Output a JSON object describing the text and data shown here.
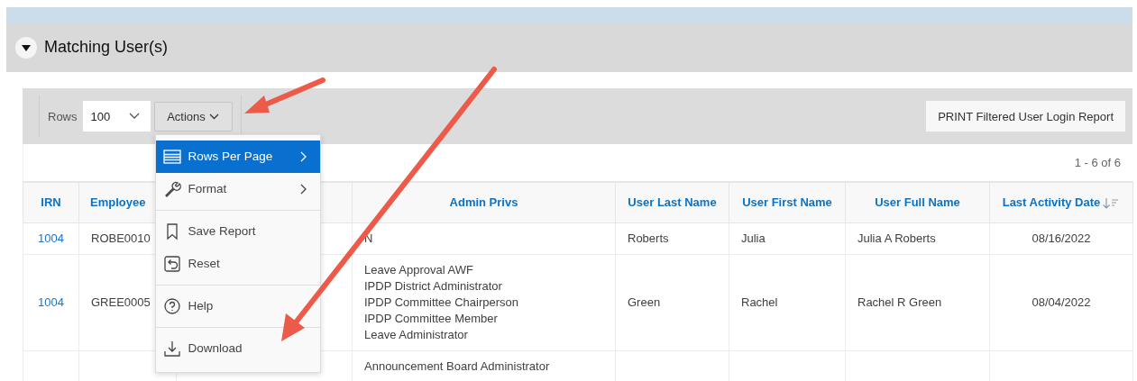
{
  "section": {
    "title": "Matching User(s)",
    "expanded": true
  },
  "toolbar": {
    "rows_label": "Rows",
    "rows_value": "100",
    "actions_label": "Actions",
    "print_button": "PRINT Filtered User Login Report"
  },
  "actions_menu": {
    "open": true,
    "groups": [
      [
        {
          "label": "Rows Per Page",
          "selected": true,
          "submenu": true
        },
        {
          "label": "Format",
          "selected": false,
          "submenu": true
        }
      ],
      [
        {
          "label": "Save Report",
          "selected": false,
          "submenu": false
        },
        {
          "label": "Reset",
          "selected": false,
          "submenu": false
        }
      ],
      [
        {
          "label": "Help",
          "selected": false,
          "submenu": false
        }
      ],
      [
        {
          "label": "Download",
          "selected": false,
          "submenu": false
        }
      ]
    ]
  },
  "pagination": "1 - 6 of 6",
  "table": {
    "columns": [
      {
        "label": "IRN",
        "sorted": false
      },
      {
        "label": "Employee",
        "sorted": false
      },
      {
        "sorted": false
      },
      {
        "label": "Admin Privs",
        "sorted": false
      },
      {
        "label": "User Last Name",
        "sorted": false
      },
      {
        "label": "User First Name",
        "sorted": false
      },
      {
        "label": "User Full Name",
        "sorted": false
      },
      {
        "label": "Last Activity Date",
        "sorted": true
      }
    ],
    "rows": [
      [
        [
          "1004"
        ],
        [
          "ROBE0010"
        ],
        null,
        [
          "N"
        ],
        [
          "Roberts"
        ],
        [
          "Julia"
        ],
        [
          "Julia A Roberts"
        ],
        [
          "08/16/2022"
        ]
      ],
      [
        [
          "1004"
        ],
        [
          "GREE0005"
        ],
        null,
        [
          "Leave Approval AWF",
          "IPDP District Administrator",
          "IPDP Committee Chairperson",
          "IPDP Committee Member",
          "Leave Administrator"
        ],
        [
          "Green"
        ],
        [
          "Rachel"
        ],
        [
          "Rachel R Green"
        ],
        [
          "08/04/2022"
        ]
      ],
      [
        null,
        null,
        null,
        [
          "Announcement Board Administrator"
        ],
        null,
        null,
        null,
        null
      ]
    ]
  }
}
